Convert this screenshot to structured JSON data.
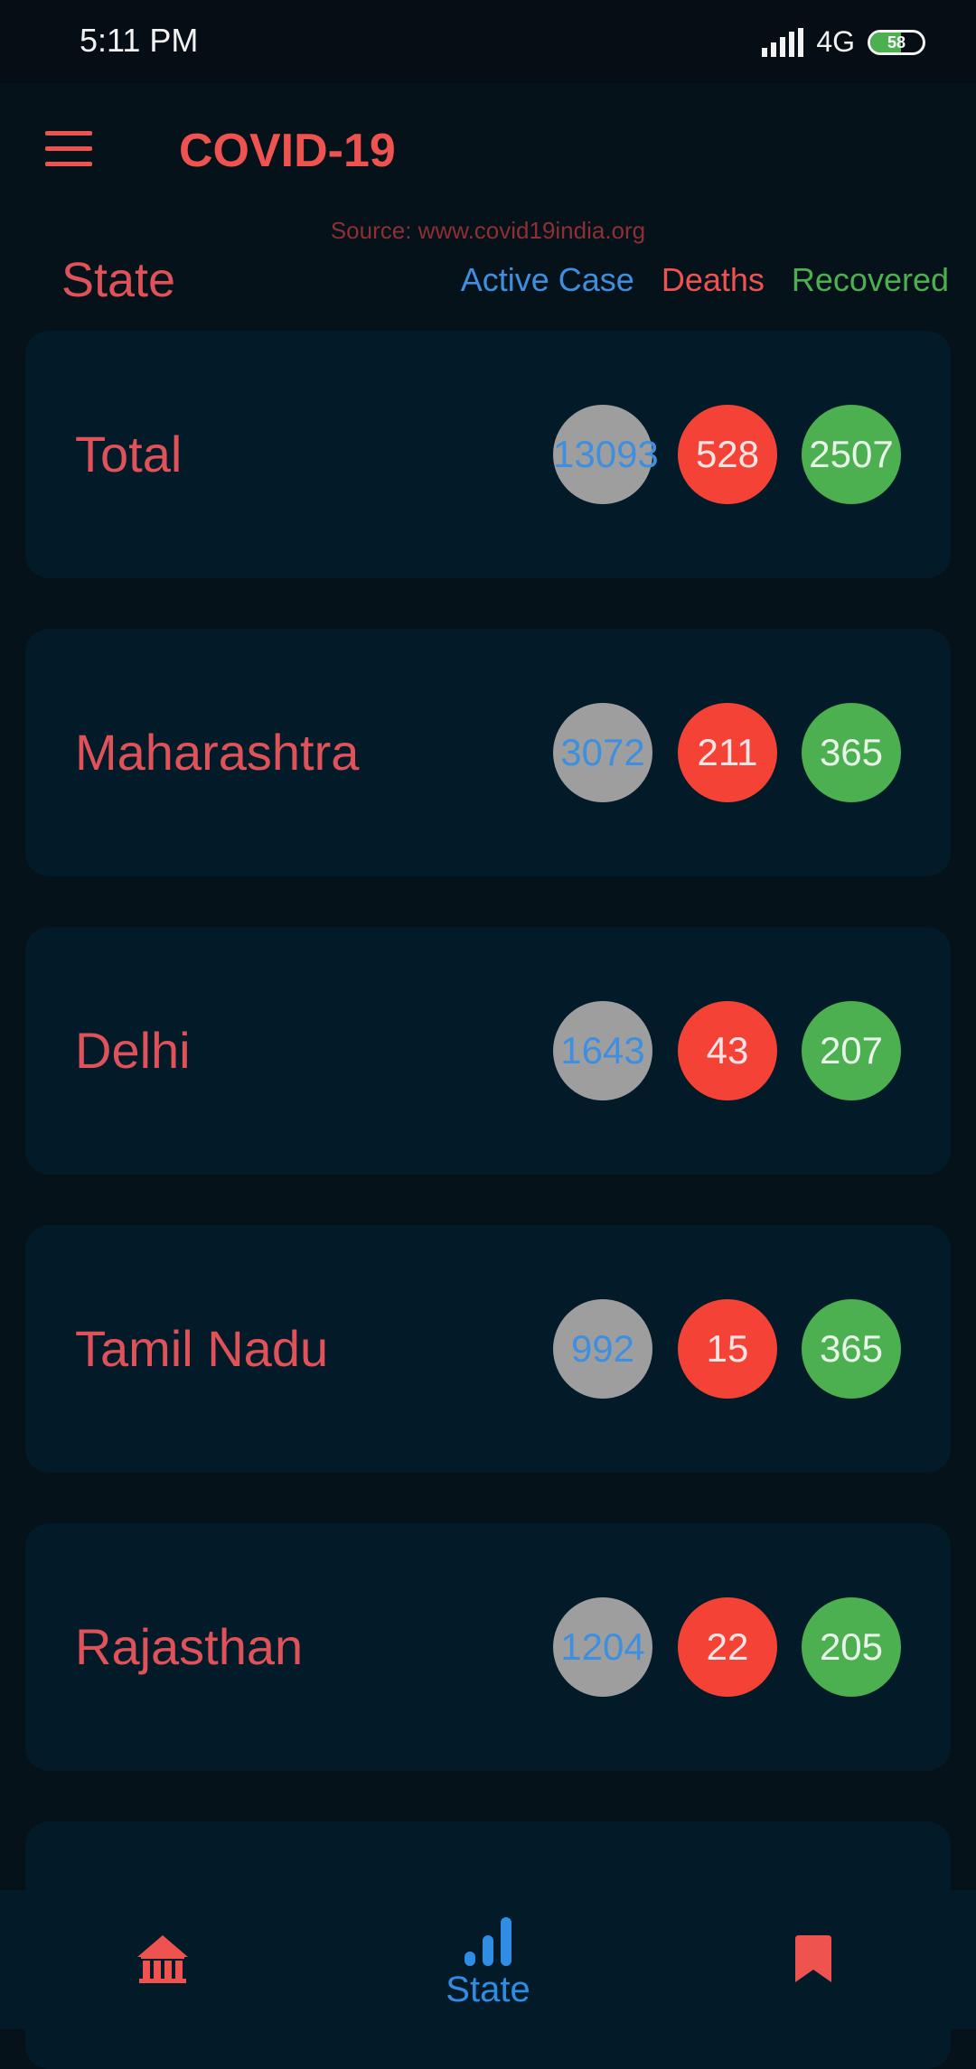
{
  "status_bar": {
    "time": "5:11 PM",
    "network": "4G",
    "battery": "58",
    "battery_level": 0.58
  },
  "app_bar": {
    "title": "COVID-19"
  },
  "source_text": "Source: www.covid19india.org",
  "header": {
    "state_label": "State",
    "legend": {
      "active": "Active Case",
      "deaths": "Deaths",
      "recovered": "Recovered"
    }
  },
  "states": [
    {
      "name": "Total",
      "active": "13093",
      "deaths": "528",
      "recovered": "2507"
    },
    {
      "name": "Maharashtra",
      "active": "3072",
      "deaths": "211",
      "recovered": "365"
    },
    {
      "name": "Delhi",
      "active": "1643",
      "deaths": "43",
      "recovered": "207"
    },
    {
      "name": "Tamil Nadu",
      "active": "992",
      "deaths": "15",
      "recovered": "365"
    },
    {
      "name": "Rajasthan",
      "active": "1204",
      "deaths": "22",
      "recovered": "205"
    }
  ],
  "bottom_nav": {
    "items": [
      {
        "icon": "home-icon"
      },
      {
        "icon": "bar-chart-icon",
        "label": "State"
      },
      {
        "icon": "bookmark-icon"
      }
    ]
  },
  "colors": {
    "accent": "#ef5350",
    "active": "#3f8fe0",
    "recovered": "#4caf50",
    "card": "#031a28",
    "background": "#05121a"
  }
}
